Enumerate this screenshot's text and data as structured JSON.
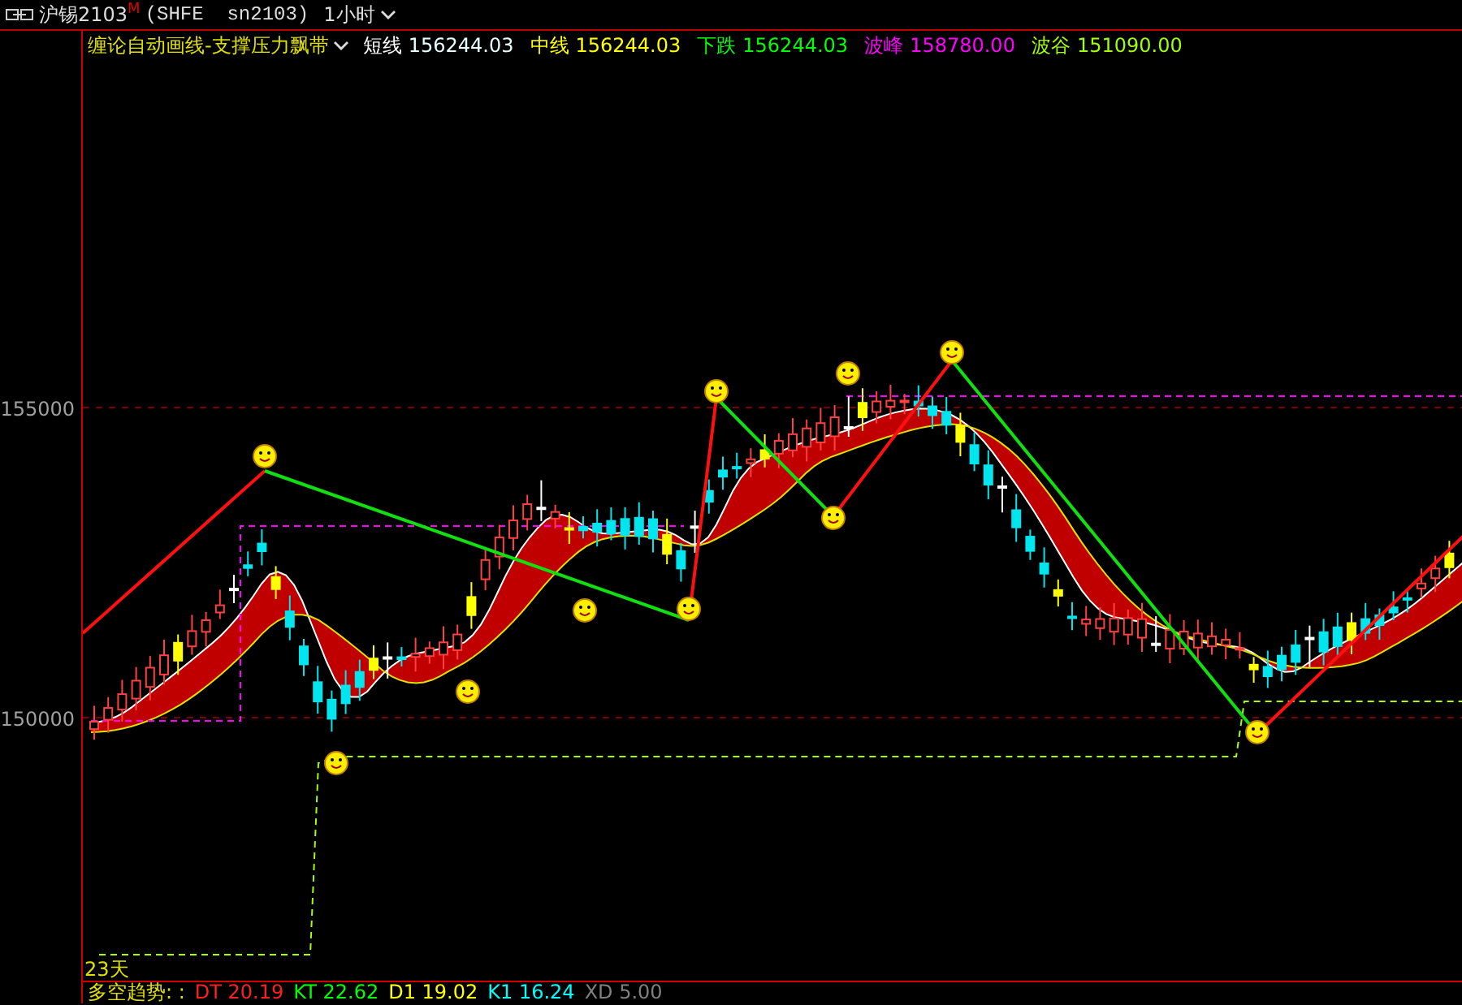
{
  "title_bar": {
    "symbol": "沪锡2103",
    "marker": "M",
    "exchange": "(SHFE  sn2103)",
    "period": "1小时"
  },
  "indicator": {
    "name": "缠论自动画线-支撑压力飘带",
    "values": [
      {
        "label": "短线",
        "value": "156244.03",
        "color": "#e8ffff"
      },
      {
        "label": "中线",
        "value": "156244.03",
        "color": "#ffff00"
      },
      {
        "label": "下跌",
        "value": "156244.03",
        "color": "#00ff00"
      },
      {
        "label": "波峰",
        "value": "158780.00",
        "color": "#ff00ff"
      },
      {
        "label": "波谷",
        "value": "151090.00",
        "color": "#a0ff00"
      }
    ]
  },
  "y_axis": {
    "ticks": [
      "155000",
      "150000"
    ]
  },
  "chart": {
    "days_label": "23天"
  },
  "sub_indicator": {
    "name": "多空趋势: :",
    "values": [
      {
        "label": "DT",
        "value": "20.19",
        "color": "#ff2020"
      },
      {
        "label": "KT",
        "value": "22.62",
        "color": "#00ff00"
      },
      {
        "label": "D1",
        "value": "19.02",
        "color": "#ffff00"
      },
      {
        "label": "K1",
        "value": "16.24",
        "color": "#00ffff"
      },
      {
        "label": "XD",
        "value": "5.00",
        "color": "#808080"
      }
    ]
  }
}
